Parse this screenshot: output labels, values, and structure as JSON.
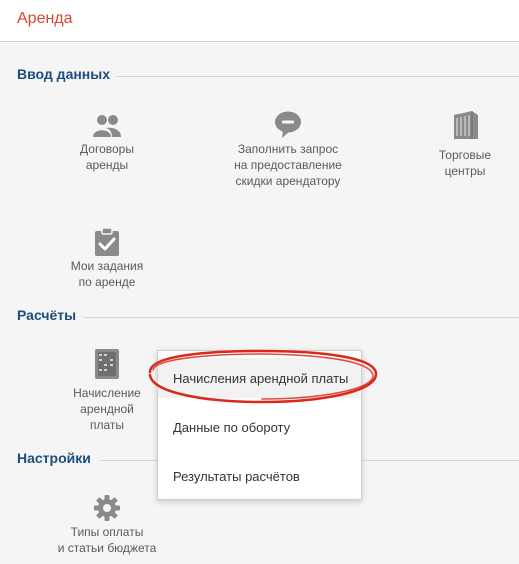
{
  "header": {
    "title": "Аренда"
  },
  "sections": {
    "data_entry": {
      "title": "Ввод данных",
      "tiles": {
        "contracts": {
          "label": "Договоры\nаренды",
          "icon": "users-icon"
        },
        "discount_request": {
          "label": "Заполнить запрос\nна предоставление\nскидки арендатору",
          "icon": "speech-bubble-icon"
        },
        "malls": {
          "label": "Торговые\nцентры",
          "icon": "building-icon"
        },
        "my_tasks": {
          "label": "Мои задания\nпо аренде",
          "icon": "clipboard-check-icon"
        }
      }
    },
    "calculations": {
      "title": "Расчёты",
      "tiles": {
        "rent_accrual": {
          "label": "Начисление\nарендной\nплаты",
          "icon": "abacus-icon"
        }
      }
    },
    "settings": {
      "title": "Настройки",
      "tiles": {
        "payment_types": {
          "label": "Типы оплаты\nи статьи бюджета",
          "icon": "gear-icon"
        }
      }
    }
  },
  "popup_menu": {
    "items": [
      "Начисления арендной платы",
      "Данные по обороту",
      "Результаты расчётов"
    ]
  },
  "colors": {
    "header_title": "#d64531",
    "section_title": "#1c4f80",
    "icon": "#8a8a8a",
    "highlight": "#d9291c"
  }
}
